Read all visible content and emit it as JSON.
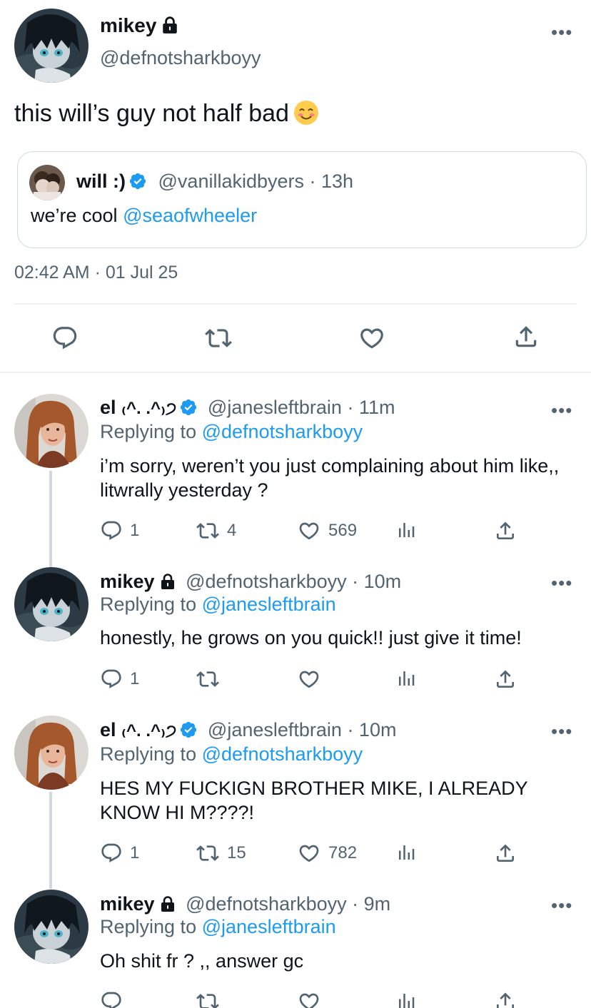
{
  "main_tweet": {
    "name": "mikey",
    "handle": "@defnotsharkboyy",
    "text": "this will’s guy not half bad",
    "more": "•••",
    "quote": {
      "name": "will :)",
      "handle": "@vanillakidbyers",
      "time": "· 13h",
      "text_prefix": "we’re cool",
      "mention": "@seaofwheeler"
    },
    "timestamp": "02:42 AM · 01 Jul 25"
  },
  "replies": [
    {
      "name": "el",
      "kaomoji": "₍^. .^₎੭",
      "handle": "@janesleftbrain",
      "time": "· 11m",
      "replying_label": "Replying to",
      "replying_to": "@defnotsharkboyy",
      "text": "i’m sorry, weren’t you just complaining about him like,, litwrally yesterday ?",
      "replies": "1",
      "retweets": "4",
      "likes": "569"
    },
    {
      "name": "mikey",
      "handle": "@defnotsharkboyy",
      "time": "· 10m",
      "replying_label": "Replying to",
      "replying_to": "@janesleftbrain",
      "text": "honestly, he grows on you quick!! just give it time!",
      "replies": "1",
      "retweets": "",
      "likes": ""
    },
    {
      "name": "el",
      "kaomoji": "₍^. .^₎੭",
      "handle": "@janesleftbrain",
      "time": "· 10m",
      "replying_label": "Replying to",
      "replying_to": "@defnotsharkboyy",
      "text": "HES MY FUCKIGN BROTHER MIKE, I ALREADY KNOW HI M????!",
      "replies": "1",
      "retweets": "15",
      "likes": "782"
    },
    {
      "name": "mikey",
      "handle": "@defnotsharkboyy",
      "time": "· 9m",
      "replying_label": "Replying to",
      "replying_to": "@janesleftbrain",
      "text": "Oh shit fr ? ,, answer gc"
    }
  ],
  "colors": {
    "accent": "#1d9bf0",
    "muted": "#536471",
    "border": "#cfd9de"
  },
  "icons": [
    "lock-icon",
    "verified-badge-icon",
    "smiling-emoji-icon",
    "reply-icon",
    "retweet-icon",
    "like-icon",
    "analytics-icon",
    "share-icon",
    "more-icon"
  ]
}
